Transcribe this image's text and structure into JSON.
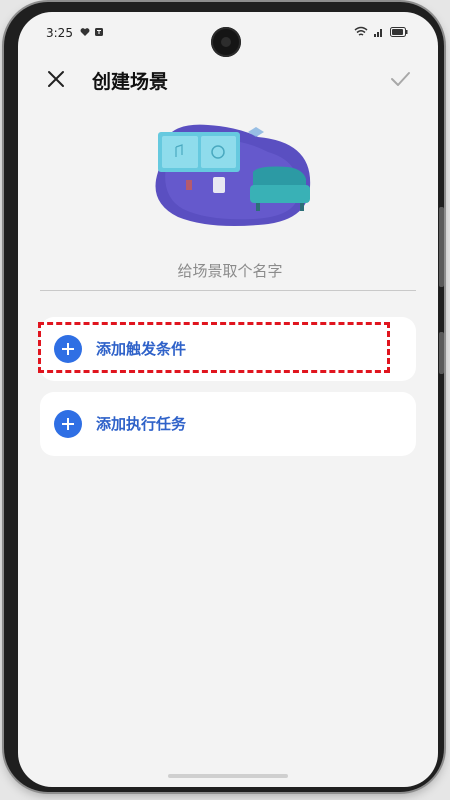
{
  "status_bar": {
    "time": "3:25"
  },
  "header": {
    "title": "创建场景"
  },
  "name_field": {
    "placeholder": "给场景取个名字",
    "value": ""
  },
  "cards": [
    {
      "label": "添加触发条件",
      "highlighted": true
    },
    {
      "label": "添加执行任务",
      "highlighted": false
    }
  ],
  "colors": {
    "accent": "#2f6fe4",
    "label_blue": "#2f62c9",
    "highlight_red": "#e0141e",
    "background": "#f3f3f3"
  },
  "icons": {
    "close": "close-icon",
    "confirm": "checkmark-icon",
    "add": "plus-circle-icon"
  }
}
